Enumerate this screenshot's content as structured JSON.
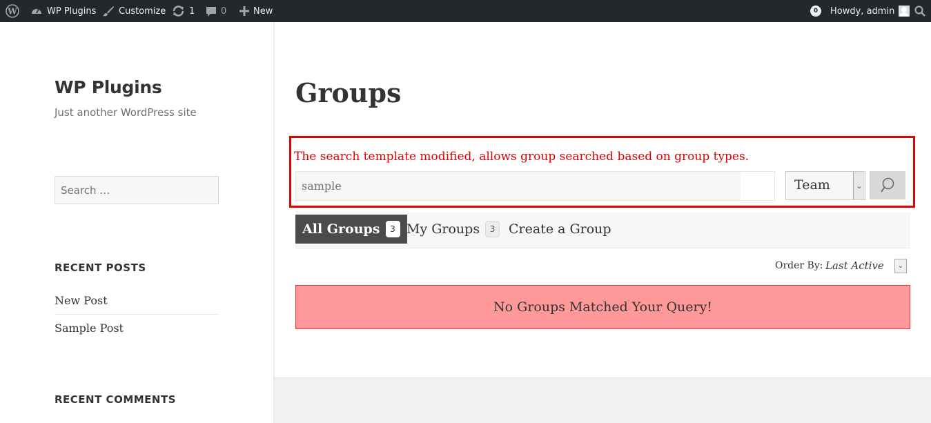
{
  "adminbar": {
    "wp_logo_icon": "wordpress-logo-icon",
    "site_name": "WP Plugins",
    "customize": "Customize",
    "updates_count": "1",
    "comments_count": "0",
    "new_label": "New",
    "notification_count": "0",
    "howdy": "Howdy, admin"
  },
  "sidebar": {
    "site_title": "WP Plugins",
    "site_description": "Just another WordPress site",
    "search_placeholder": "Search …",
    "recent_posts_title": "RECENT POSTS",
    "recent_posts": [
      "New Post",
      "Sample Post"
    ],
    "recent_comments_title": "RECENT COMMENTS"
  },
  "main": {
    "page_title": "Groups",
    "notice": "The search template modified, allows group searched based on group types.",
    "search_value": "sample",
    "group_type_selected": "Team",
    "tabs": [
      {
        "label": "All Groups",
        "count": "3"
      },
      {
        "label": "My Groups",
        "count": "3"
      },
      {
        "label": "Create a Group"
      }
    ],
    "order_by_label": "Order By:",
    "order_by_value": "Last Active",
    "no_results": "No Groups Matched Your Query!"
  },
  "colors": {
    "adminbar_bg": "#23282d",
    "highlight_border": "#e00000",
    "no_results_bg": "#ff9999",
    "active_tab_bg": "#4b4b4b"
  }
}
